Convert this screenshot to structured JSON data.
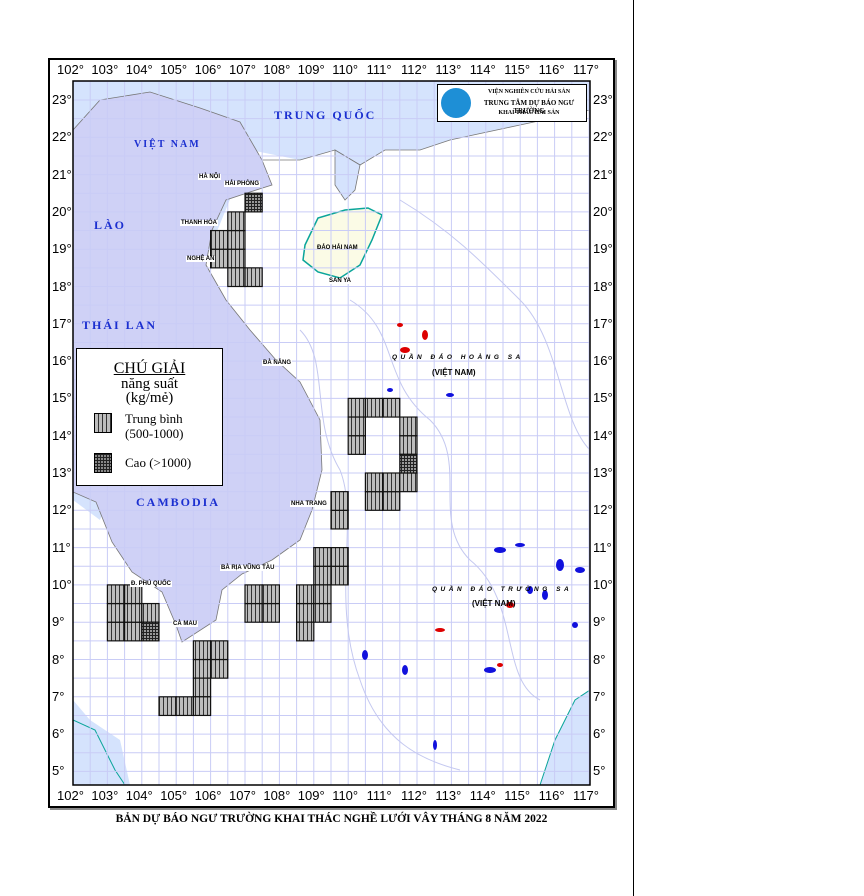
{
  "caption": "BẢN DỰ BÁO NGƯ TRƯỜNG KHAI THÁC NGHỀ LƯỚI VÂY THÁNG 8 NĂM 2022",
  "logo": {
    "line1": "VIỆN NGHIÊN CỨU HẢI SẢN",
    "line2": "TRUNG TÂM DỰ BÁO NGƯ TRƯỜNG",
    "line3": "KHAI THÁC HẢI SẢN"
  },
  "legend": {
    "title": "CHÚ GIẢI",
    "subtitle1": "năng suất",
    "subtitle2": "(kg/mẻ)",
    "medium_label": "Trung bình",
    "medium_range": "(500-1000)",
    "high_label": "Cao (>1000)"
  },
  "axes": {
    "longitudes": [
      "102°",
      "103°",
      "104°",
      "105°",
      "106°",
      "107°",
      "108°",
      "109°",
      "110°",
      "111°",
      "112°",
      "113°",
      "114°",
      "115°",
      "116°",
      "117°"
    ],
    "latitudes": [
      "23°",
      "22°",
      "21°",
      "20°",
      "19°",
      "18°",
      "17°",
      "16°",
      "15°",
      "14°",
      "13°",
      "12°",
      "11°",
      "10°",
      "9°",
      "8°",
      "7°",
      "6°",
      "5°"
    ]
  },
  "places": {
    "trung_quoc": "TRUNG QUỐC",
    "viet_nam": "VIỆT NAM",
    "lao": "LÀO",
    "thai_lan": "THÁI LAN",
    "cambodia": "CAMBODIA",
    "ha_noi": "HÀ NỘI",
    "hai_phong": "HẢI PHÒNG",
    "thanh_hoa": "THANH HÓA",
    "nghe_an": "NGHỆ AN",
    "dao_hai_nam": "ĐẢO HẢI NAM",
    "san_ya": "SAN YA",
    "da_nang": "ĐÀ NẴNG",
    "nha_trang": "NHA TRANG",
    "vung_tau": "BÀ RỊA VŨNG TÀU",
    "phu_quoc": "Đ. PHÚ QUỐC",
    "ca_mau": "CÀ MAU",
    "hoang_sa": "QUẦN ĐẢO HOÀNG SA",
    "hoang_sa_vn": "(VIỆT NAM)",
    "truong_sa": "QUẦN ĐẢO TRƯỜNG SA",
    "truong_sa_vn": "(VIỆT NAM)"
  },
  "colors": {
    "medium": "#bdbdbd",
    "high": "#4a4a4a",
    "land": "#cfd1f6",
    "grid": "#c9ccf6",
    "hainan": "#fbfbe6"
  },
  "zones": [
    {
      "level": "high",
      "cells": [
        [
          107.0,
          20.0,
          107.5,
          20.5
        ],
        [
          111.5,
          13.0,
          112.0,
          13.5
        ],
        [
          104.0,
          8.5,
          104.5,
          9.0
        ]
      ]
    },
    {
      "level": "medium",
      "cells": [
        [
          106.5,
          18.5,
          107.0,
          20.0
        ],
        [
          106.0,
          18.5,
          106.5,
          19.5
        ],
        [
          106.5,
          18.0,
          107.5,
          18.5
        ],
        [
          110.0,
          14.5,
          111.5,
          15.0
        ],
        [
          110.0,
          13.5,
          110.5,
          14.5
        ],
        [
          111.5,
          13.5,
          112.0,
          14.5
        ],
        [
          110.5,
          12.0,
          111.5,
          13.0
        ],
        [
          111.5,
          12.5,
          112.0,
          13.0
        ],
        [
          109.5,
          11.5,
          110.0,
          12.5
        ],
        [
          109.0,
          10.0,
          110.0,
          11.0
        ],
        [
          108.5,
          9.0,
          109.5,
          10.0
        ],
        [
          108.5,
          8.5,
          109.0,
          9.0
        ],
        [
          107.0,
          9.0,
          108.0,
          10.0
        ],
        [
          103.0,
          8.5,
          104.0,
          10.0
        ],
        [
          104.0,
          9.0,
          104.5,
          9.5
        ],
        [
          105.5,
          7.5,
          106.5,
          8.5
        ],
        [
          105.5,
          7.0,
          106.0,
          7.5
        ],
        [
          104.5,
          6.5,
          106.0,
          7.0
        ]
      ]
    }
  ]
}
